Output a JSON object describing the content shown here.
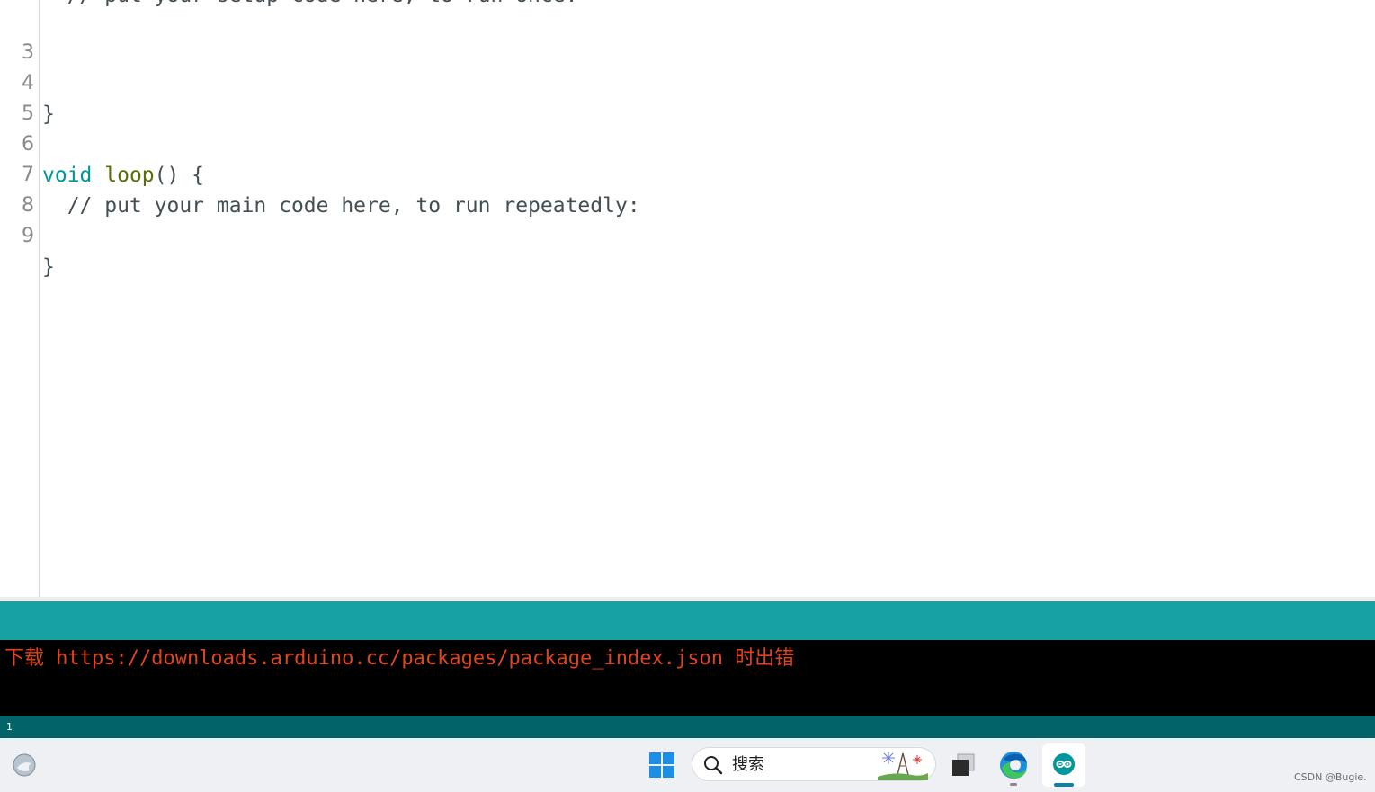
{
  "editor": {
    "partial_line": "  // put your setup code here, to run once:",
    "lines": [
      {
        "num": "3",
        "code": ""
      },
      {
        "num": "4",
        "code": "}"
      },
      {
        "num": "5",
        "code": ""
      },
      {
        "num": "6",
        "kw": "void",
        "fn": "loop",
        "rest": "() {"
      },
      {
        "num": "7",
        "code": "  // put your main code here, to run repeatedly:"
      },
      {
        "num": "8",
        "code": ""
      },
      {
        "num": "9",
        "code": "}"
      }
    ]
  },
  "console": {
    "message": "下载 https://downloads.arduino.cc/packages/package_index.json 时出错"
  },
  "status_bar": {
    "line_number": "1"
  },
  "taskbar": {
    "search_placeholder": "搜索",
    "watermark": "CSDN @Bugie."
  },
  "colors": {
    "accent_teal": "#17a1a5",
    "status_dark_teal": "#006468",
    "error_text": "#e0441c",
    "keyword_type": "#00979c",
    "keyword_function": "#5e6d03"
  },
  "icons": [
    "widgets-icon",
    "windows-start-icon",
    "search-icon",
    "task-view-icon",
    "edge-browser-icon",
    "arduino-ide-icon"
  ]
}
